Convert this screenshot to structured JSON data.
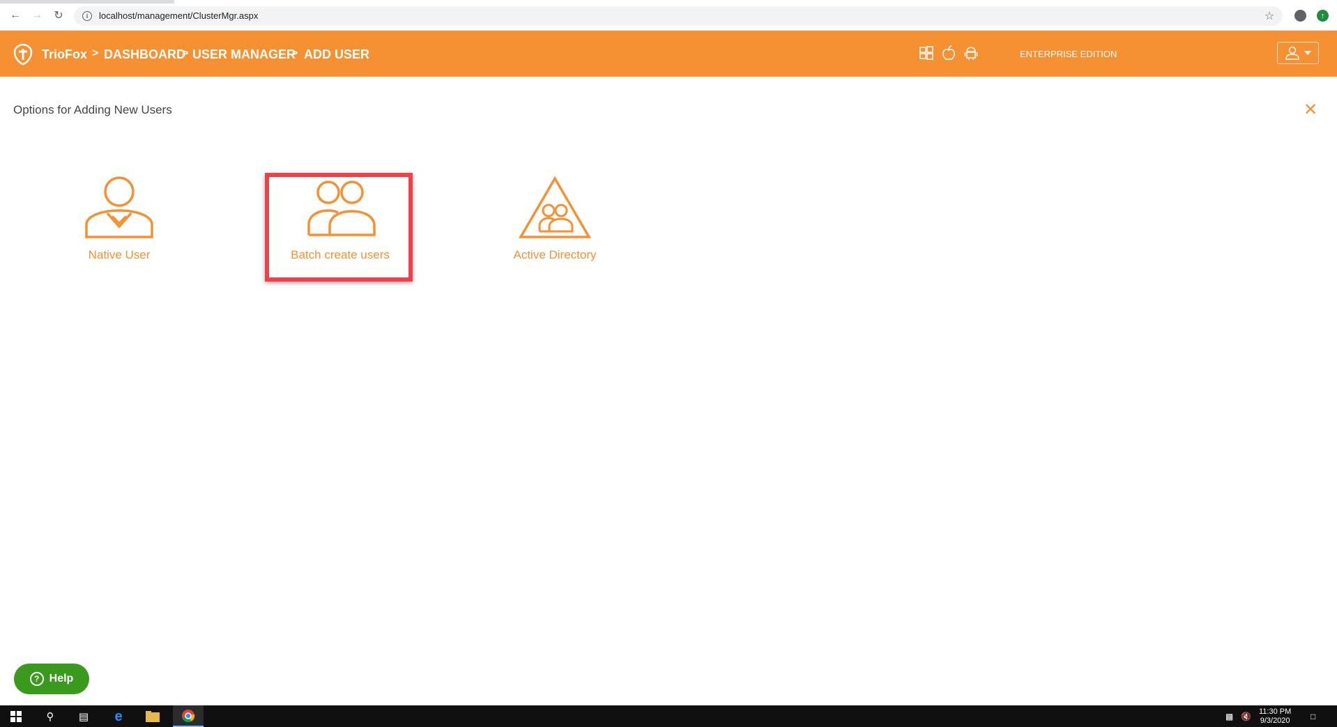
{
  "browser": {
    "url": "localhost/management/ClusterMgr.aspx"
  },
  "header": {
    "brand": "TrioFox",
    "breadcrumbs": [
      "DASHBOARD",
      "USER MANAGER",
      "ADD USER"
    ],
    "separator": ">",
    "edition": "ENTERPRISE EDITION",
    "os_icons": [
      "windows-icon",
      "apple-icon",
      "android-icon"
    ],
    "accent_color": "#f59132"
  },
  "page": {
    "title": "Options for Adding New Users",
    "options": [
      {
        "label": "Native User",
        "icon": "single-user-icon"
      },
      {
        "label": "Batch create users",
        "icon": "multiple-users-icon"
      },
      {
        "label": "Active Directory",
        "icon": "active-directory-icon"
      }
    ],
    "highlighted_option": "Batch create users",
    "highlight_color": "#f0404a"
  },
  "help": {
    "label": "Help",
    "color": "#3a9a1e"
  },
  "taskbar": {
    "time": "11:30 PM",
    "date": "9/3/2020"
  }
}
